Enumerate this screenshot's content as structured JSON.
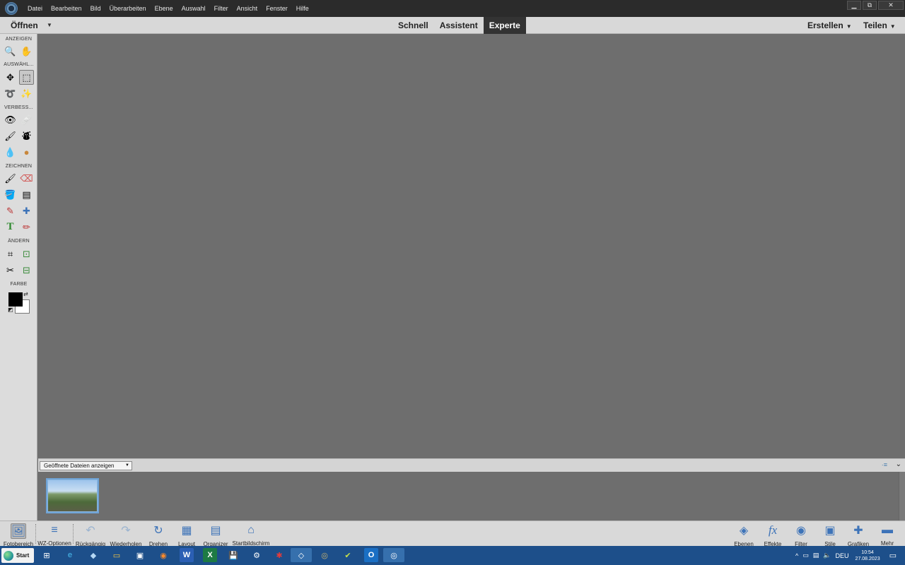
{
  "menubar": {
    "items": [
      "Datei",
      "Bearbeiten",
      "Bild",
      "Überarbeiten",
      "Ebene",
      "Auswahl",
      "Filter",
      "Ansicht",
      "Fenster",
      "Hilfe"
    ],
    "win_min": "▁",
    "win_restore": "⧉",
    "win_close": "✕"
  },
  "modebar": {
    "open_label": "Öffnen",
    "open_arrow": "▼",
    "tabs": [
      "Schnell",
      "Assistent",
      "Experte"
    ],
    "active_tab": "Experte",
    "create_label": "Erstellen",
    "share_label": "Teilen",
    "caret": "▼"
  },
  "toolbox": {
    "headings": {
      "view": "ANZEIGEN",
      "select": "AUSWÄHL...",
      "enhance": "VERBESS...",
      "draw": "ZEICHNEN",
      "modify": "ÄNDERN",
      "color": "FARBE"
    },
    "tools": {
      "zoom": "🔍",
      "hand": "✋",
      "move": "✥",
      "marquee": "⬚",
      "lasso": "➰",
      "magic_wand": "✨",
      "red_eye": "👁",
      "spot_healing": "🩹",
      "smart_brush": "🖌",
      "clone_stamp": "⛇",
      "blur": "💧",
      "sponge": "●",
      "brush": "🖌",
      "eraser": "⌫",
      "paint_bucket": "🪣",
      "gradient": "▤",
      "eyedropper": "✎",
      "custom_shape": "✚",
      "type": "T",
      "pencil": "✏",
      "crop": "⌗",
      "recompose": "⊡",
      "content_aware_move": "✂",
      "straighten": "⊟"
    },
    "swap_glyph": "⇄",
    "default_glyph": "◩"
  },
  "photo_bin": {
    "dropdown_label": "Geöffnete Dateien anzeigen",
    "dropdown_arrow": "▼",
    "menu_glyph": "·≡",
    "collapse_glyph": "⌄"
  },
  "taskbar": {
    "buttons": [
      {
        "label": "Fotobereich",
        "glyph": "🖼"
      },
      {
        "label": "WZ-Optionen",
        "glyph": "≡"
      },
      {
        "label": "Rückgängig",
        "glyph": "↶"
      },
      {
        "label": "Wiederholen",
        "glyph": "↷"
      },
      {
        "label": "Drehen",
        "glyph": "↻"
      },
      {
        "label": "Layout",
        "glyph": "▦"
      },
      {
        "label": "Organizer",
        "glyph": "▤"
      },
      {
        "label": "Startbildschirm",
        "glyph": "⌂"
      }
    ],
    "right_buttons": [
      {
        "label": "Ebenen",
        "glyph": "◈"
      },
      {
        "label": "Effekte",
        "glyph": "fx"
      },
      {
        "label": "Filter",
        "glyph": "◉"
      },
      {
        "label": "Stile",
        "glyph": "▣"
      },
      {
        "label": "Grafiken",
        "glyph": "✚"
      },
      {
        "label": "Mehr",
        "glyph": "▬"
      }
    ]
  },
  "win_taskbar": {
    "start_label": "Start",
    "apps": [
      "⊞",
      "e",
      "◆",
      "▭",
      "▣",
      "◉",
      "W",
      "X",
      "💾",
      "⚙",
      "✱",
      "◇",
      "◎",
      "✔",
      "O",
      "◎"
    ],
    "tray": {
      "chevron": "^",
      "lang": "DEU",
      "time": "10:54",
      "date": "27.08.2023",
      "notification": "▭"
    }
  }
}
